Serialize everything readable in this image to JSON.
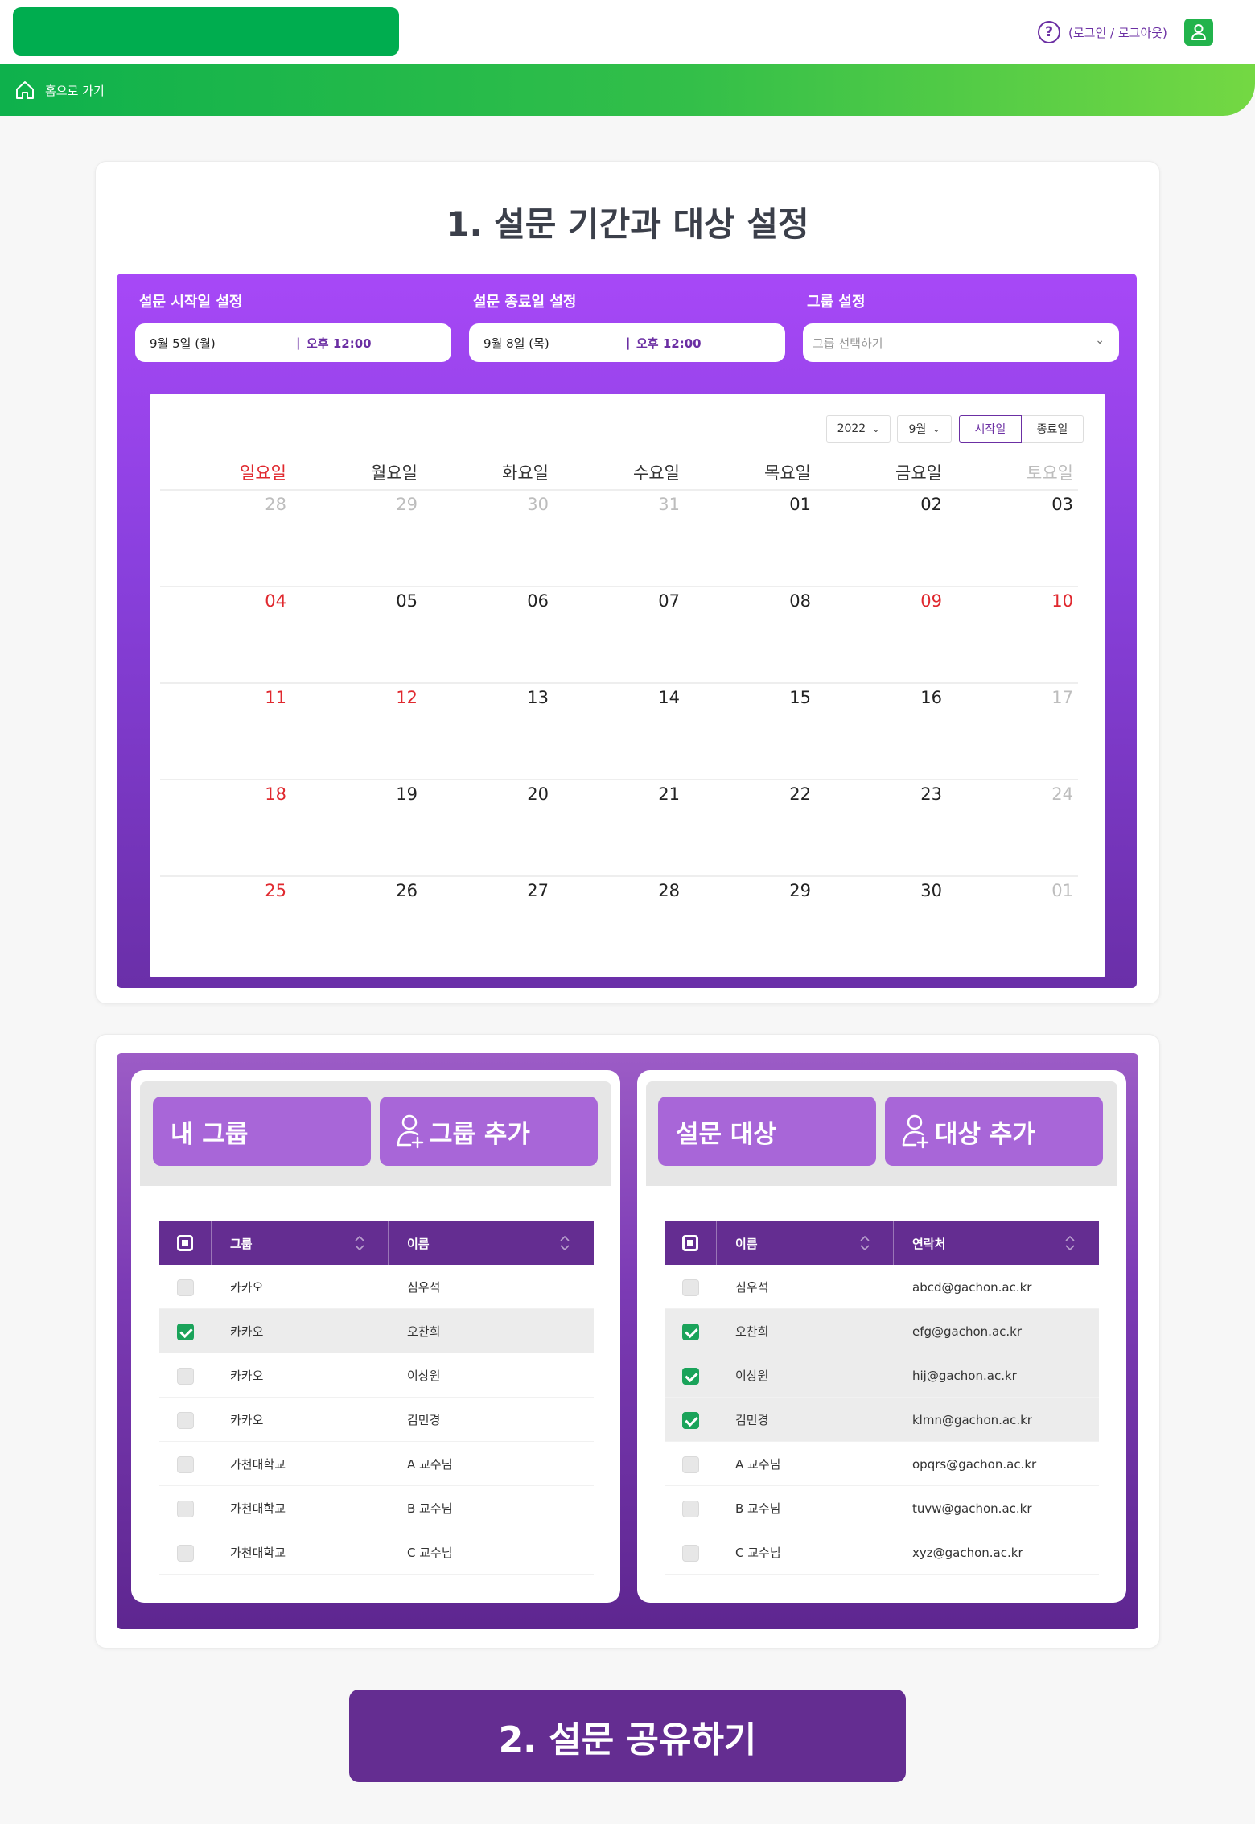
{
  "header": {
    "login_text": "(로그인 / 로그아웃)",
    "home_label": "홈으로 가기",
    "brand_color": "#00ad4f"
  },
  "section1": {
    "title": "1. 설문 기간과 대상 설정",
    "start_label": "설문 시작일 설정",
    "start_date": "9월 5일 (월)",
    "start_time": "오후 12:00",
    "end_label": "설문 종료일 설정",
    "end_date": "9월 8일 (목)",
    "end_time": "오후 12:00",
    "time_sep": "|",
    "group_label": "그룹 설정",
    "group_placeholder": "그룹 선택하기"
  },
  "calendar": {
    "year": "2022",
    "month": "9월",
    "mode_start": "시작일",
    "mode_end": "종료일",
    "weekdays": [
      "일요일",
      "월요일",
      "화요일",
      "수요일",
      "목요일",
      "금요일",
      "토요일"
    ],
    "weeks": [
      [
        {
          "d": "28",
          "c": "gray"
        },
        {
          "d": "29",
          "c": "gray"
        },
        {
          "d": "30",
          "c": "gray"
        },
        {
          "d": "31",
          "c": "gray"
        },
        {
          "d": "01",
          "c": ""
        },
        {
          "d": "02",
          "c": ""
        },
        {
          "d": "03",
          "c": ""
        }
      ],
      [
        {
          "d": "04",
          "c": "red"
        },
        {
          "d": "05",
          "c": ""
        },
        {
          "d": "06",
          "c": ""
        },
        {
          "d": "07",
          "c": ""
        },
        {
          "d": "08",
          "c": ""
        },
        {
          "d": "09",
          "c": "red"
        },
        {
          "d": "10",
          "c": "red"
        }
      ],
      [
        {
          "d": "11",
          "c": "red"
        },
        {
          "d": "12",
          "c": "red"
        },
        {
          "d": "13",
          "c": ""
        },
        {
          "d": "14",
          "c": ""
        },
        {
          "d": "15",
          "c": ""
        },
        {
          "d": "16",
          "c": ""
        },
        {
          "d": "17",
          "c": "gray"
        }
      ],
      [
        {
          "d": "18",
          "c": "red"
        },
        {
          "d": "19",
          "c": ""
        },
        {
          "d": "20",
          "c": ""
        },
        {
          "d": "21",
          "c": ""
        },
        {
          "d": "22",
          "c": ""
        },
        {
          "d": "23",
          "c": ""
        },
        {
          "d": "24",
          "c": "gray"
        }
      ],
      [
        {
          "d": "25",
          "c": "red"
        },
        {
          "d": "26",
          "c": ""
        },
        {
          "d": "27",
          "c": ""
        },
        {
          "d": "28",
          "c": ""
        },
        {
          "d": "29",
          "c": ""
        },
        {
          "d": "30",
          "c": ""
        },
        {
          "d": "01",
          "c": "gray"
        }
      ]
    ]
  },
  "groups": {
    "tab_label": "내 그룹",
    "add_label": "그룹 추가",
    "col_group": "그룹",
    "col_name": "이름",
    "rows": [
      {
        "group": "카카오",
        "name": "심우석",
        "checked": false
      },
      {
        "group": "카카오",
        "name": "오찬희",
        "checked": true
      },
      {
        "group": "카카오",
        "name": "이상원",
        "checked": false
      },
      {
        "group": "카카오",
        "name": "김민경",
        "checked": false
      },
      {
        "group": "가천대학교",
        "name": "A 교수님",
        "checked": false
      },
      {
        "group": "가천대학교",
        "name": "B 교수님",
        "checked": false
      },
      {
        "group": "가천대학교",
        "name": "C 교수님",
        "checked": false
      }
    ]
  },
  "targets": {
    "tab_label": "설문 대상",
    "add_label": "대상 추가",
    "col_name": "이름",
    "col_contact": "연락처",
    "rows": [
      {
        "name": "심우석",
        "contact": "abcd@gachon.ac.kr",
        "checked": false
      },
      {
        "name": "오찬희",
        "contact": "efg@gachon.ac.kr",
        "checked": true
      },
      {
        "name": "이상원",
        "contact": "hij@gachon.ac.kr",
        "checked": true
      },
      {
        "name": "김민경",
        "contact": "klmn@gachon.ac.kr",
        "checked": true
      },
      {
        "name": "A 교수님",
        "contact": "opqrs@gachon.ac.kr",
        "checked": false
      },
      {
        "name": "B 교수님",
        "contact": "tuvw@gachon.ac.kr",
        "checked": false
      },
      {
        "name": "C 교수님",
        "contact": "xyz@gachon.ac.kr",
        "checked": false
      }
    ]
  },
  "share_label": "2. 설문 공유하기"
}
